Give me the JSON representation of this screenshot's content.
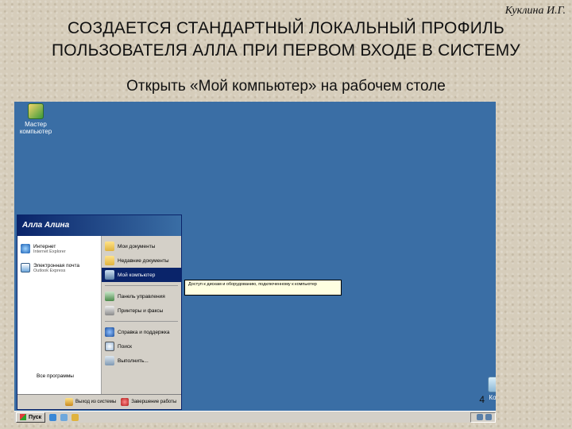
{
  "slide": {
    "author": "Куклина И.Г.",
    "title_line1": "СОЗДАЕТСЯ СТАНДАРТНЫЙ ЛОКАЛЬНЫЙ ПРОФИЛЬ",
    "title_line2": "ПОЛЬЗОВАТЕЛЯ АЛЛА ПРИ ПЕРВОМ ВХОДЕ В СИСТЕМУ",
    "subtitle": "Открыть «Мой компьютер» на рабочем столе",
    "slide_number": "4"
  },
  "desktop": {
    "icons": [
      {
        "label": "Мастер компьютер",
        "icon": "wizard-icon"
      },
      {
        "label": "Корз",
        "icon": "recycle-bin-icon"
      }
    ],
    "background_color": "#3a6ea5"
  },
  "start_menu": {
    "user_name": "Алла Алина",
    "pinned": [
      {
        "label": "Интернет",
        "sublabel": "Internet Explorer",
        "icon": "internet-explorer-icon"
      },
      {
        "label": "Электронная почта",
        "sublabel": "Outlook Express",
        "icon": "email-icon"
      }
    ],
    "all_programs": "Все программы",
    "places": [
      {
        "label": "Мои документы",
        "icon": "folder-icon"
      },
      {
        "label": "Недавние документы",
        "icon": "folder-icon"
      },
      {
        "label": "Мой компьютер",
        "icon": "computer-icon",
        "selected": true
      }
    ],
    "settings": [
      {
        "label": "Панель управления",
        "icon": "control-panel-icon"
      },
      {
        "label": "Принтеры и факсы",
        "icon": "printer-icon"
      }
    ],
    "tools": [
      {
        "label": "Справка и поддержка",
        "icon": "help-icon"
      },
      {
        "label": "Поиск",
        "icon": "search-icon"
      },
      {
        "label": "Выполнить...",
        "icon": "run-icon"
      }
    ],
    "logoff_label": "Выход из системы",
    "shutdown_label": "Завершение работы"
  },
  "tooltip": {
    "text": "Доступ к дискам и оборудованию, подключенному к компьютер"
  },
  "taskbar": {
    "start_label": "Пуск"
  }
}
